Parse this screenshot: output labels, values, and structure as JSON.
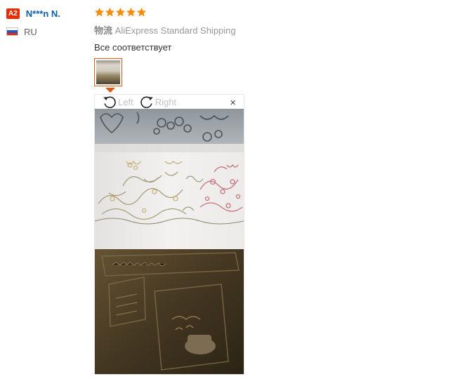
{
  "user": {
    "level_badge": "A2",
    "name": "N***n N.",
    "country_code": "RU",
    "country_flag_colors": [
      "#ffffff",
      "#2a56b8",
      "#d52b1e"
    ]
  },
  "review": {
    "rating": 5,
    "rating_max": 5,
    "star_color": "#f78c0a",
    "shipping_label": "物流",
    "shipping_method": "AliExpress Standard Shipping",
    "text": "Все соответствует"
  },
  "viewer": {
    "rotate_left_label": "Left",
    "rotate_right_label": "Right",
    "close_glyph": "×",
    "left_icon": "rotate-left-icon",
    "right_icon": "rotate-right-icon"
  },
  "colors": {
    "accent": "#e05a12",
    "username": "#0b5ea8",
    "badge": "#e62e04"
  }
}
